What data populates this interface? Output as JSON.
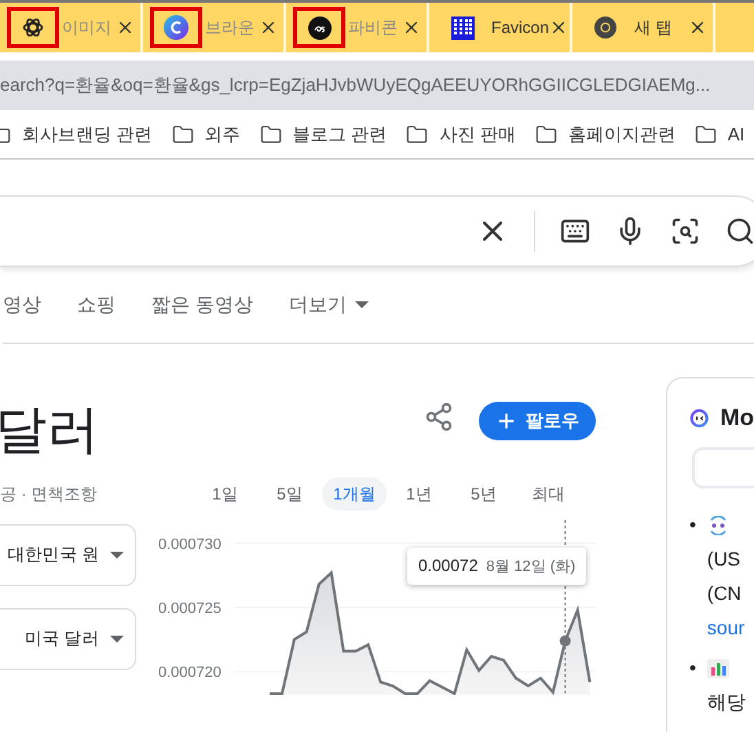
{
  "tabs": [
    {
      "title": "이미지",
      "kind": "knot",
      "highlighted": true
    },
    {
      "title": "브라운",
      "kind": "swirl",
      "highlighted": true
    },
    {
      "title": "파비콘",
      "kind": "monogram",
      "highlighted": true
    },
    {
      "title": "Favicon",
      "kind": "pixel",
      "highlighted": false
    },
    {
      "title": "새 탭",
      "kind": "browser",
      "highlighted": false
    }
  ],
  "address_bar": {
    "url": "earch?q=환율&oq=환율&gs_lcrp=EgZjaHJvbWUyEQgAEEUYORhGGIICGLEDGIAEMg..."
  },
  "bookmarks": [
    "회사브랜딩 관련",
    "외주",
    "블로그 관련",
    "사진 판매",
    "홈페이지관련",
    "AI"
  ],
  "search_nav": [
    {
      "label": "영상",
      "kind": "link"
    },
    {
      "label": "쇼핑",
      "kind": "link"
    },
    {
      "label": "짧은 동영상",
      "kind": "link"
    },
    {
      "label": "더보기",
      "kind": "menu"
    }
  ],
  "currency": {
    "title": "달러",
    "disclaimer": "공 · 면책조항",
    "follow": "팔로우",
    "ranges": [
      {
        "label": "1일",
        "selected": false
      },
      {
        "label": "5일",
        "selected": false
      },
      {
        "label": "1개월",
        "selected": true
      },
      {
        "label": "1년",
        "selected": false
      },
      {
        "label": "5년",
        "selected": false
      },
      {
        "label": "최대",
        "selected": false
      }
    ],
    "from_currency": "대한민국 원",
    "to_currency": "미국 달러",
    "chart_data": {
      "type": "area",
      "ylim": [
        0.0007182,
        0.0007318
      ],
      "yticks": [
        {
          "value": 0.00073,
          "label": "0.000730"
        },
        {
          "value": 0.000725,
          "label": "0.000725"
        },
        {
          "value": 0.00072,
          "label": "0.000720"
        }
      ],
      "series": [
        {
          "color": "#70757a",
          "values": [
            0.0007183,
            0.0007183,
            0.0007225,
            0.0007231,
            0.0007268,
            0.0007277,
            0.0007216,
            0.0007216,
            0.0007221,
            0.0007192,
            0.0007189,
            0.0007183,
            0.0007183,
            0.0007193,
            0.0007188,
            0.0007183,
            0.0007217,
            0.0007201,
            0.0007212,
            0.0007209,
            0.0007195,
            0.0007189,
            0.0007195,
            0.0007184,
            0.0007224,
            0.0007248,
            0.0007192
          ]
        }
      ],
      "grid": true
    },
    "tooltip": {
      "value": "0.00072",
      "date": "8월 12일 (화)"
    }
  },
  "side_panel": {
    "title": "Mo",
    "items": [
      {
        "kind": "exchange",
        "marker": "•",
        "lines": [
          "(US",
          "(CN"
        ],
        "link": "sour"
      },
      {
        "kind": "bars",
        "marker": "•",
        "lines": [
          "해당"
        ]
      }
    ]
  }
}
